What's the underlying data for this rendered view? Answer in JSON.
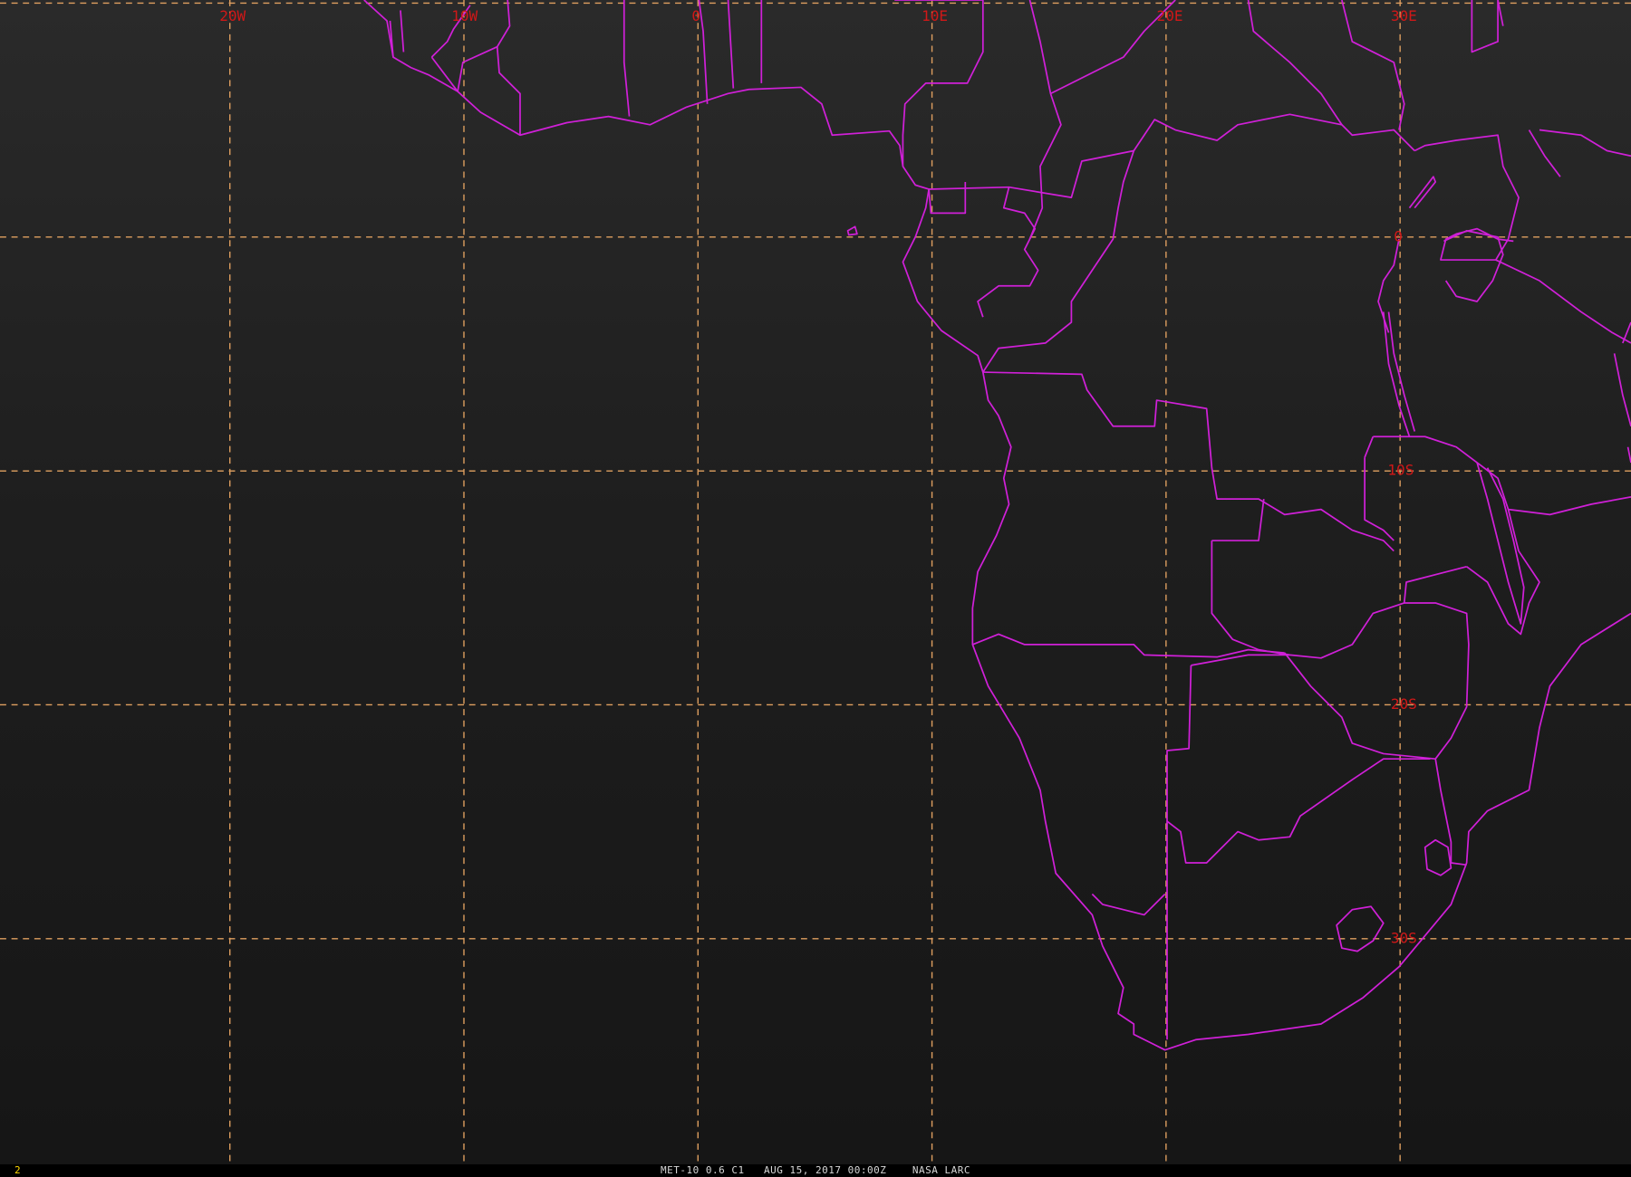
{
  "map": {
    "longitude_labels": [
      "20W",
      "10W",
      "0",
      "10E",
      "20E",
      "30E"
    ],
    "latitude_labels": [
      "0",
      "10S",
      "20S",
      "30S"
    ],
    "colors": {
      "background": "#1e1e1e",
      "grid": "#e0a060",
      "grid_labels": "#d01818",
      "borders": "#d020d8"
    }
  },
  "status_bar": {
    "frame_number": "2",
    "satellite": "MET-10",
    "channel": "0.6 C1",
    "datetime": "AUG 15, 2017 00:00Z",
    "source": "NASA LARC"
  }
}
